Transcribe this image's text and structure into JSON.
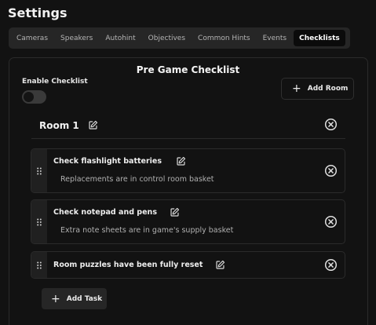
{
  "page": {
    "title": "Settings"
  },
  "tabs": [
    {
      "label": "Cameras",
      "active": false
    },
    {
      "label": "Speakers",
      "active": false
    },
    {
      "label": "Autohint",
      "active": false
    },
    {
      "label": "Objectives",
      "active": false
    },
    {
      "label": "Common Hints",
      "active": false
    },
    {
      "label": "Events",
      "active": false
    },
    {
      "label": "Checklists",
      "active": true
    }
  ],
  "checklist": {
    "title": "Pre Game Checklist",
    "enable_label": "Enable Checklist",
    "enabled": false,
    "add_room_label": "Add Room",
    "rooms": [
      {
        "name": "Room 1",
        "tasks": [
          {
            "title": "Check flashlight batteries",
            "description": "Replacements are in control room basket"
          },
          {
            "title": "Check notepad and pens",
            "description": "Extra note sheets are in game's supply basket"
          },
          {
            "title": "Room puzzles have been fully reset",
            "description": ""
          }
        ],
        "add_task_label": "Add Task"
      }
    ]
  },
  "icons": {
    "edit": "pencil-square-icon",
    "remove": "circle-x-icon",
    "drag": "grip-vertical-icon",
    "add": "plus-icon"
  },
  "colors": {
    "background": "#121212",
    "panel_border": "#2b2b2b",
    "tab_bar": "#262626",
    "active_tab": "#0b0b0b",
    "text": "#eeeeee",
    "muted_text": "#b0b0b0"
  }
}
